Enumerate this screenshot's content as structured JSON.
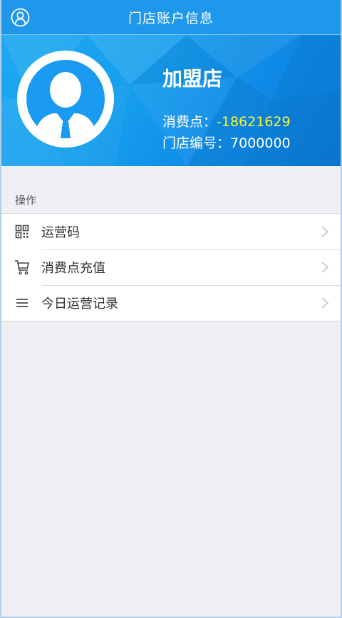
{
  "header": {
    "title": "门店账户信息",
    "user_icon": "user-circle-icon"
  },
  "profile": {
    "avatar_icon": "avatar-person-icon",
    "store_name": "加盟店",
    "points_label": "消费点：",
    "points_value": "-18621629",
    "code_label": "门店编号：",
    "code_value": "7000000"
  },
  "section": {
    "label": "操作"
  },
  "menu": {
    "items": [
      {
        "label": "运营码",
        "icon": "qrcode-icon"
      },
      {
        "label": "消费点充值",
        "icon": "cart-icon"
      },
      {
        "label": "今日运营记录",
        "icon": "list-icon"
      }
    ]
  },
  "colors": {
    "topbar": "#1f97ea",
    "points_value": "#f7f53a",
    "background": "#efeff4"
  }
}
